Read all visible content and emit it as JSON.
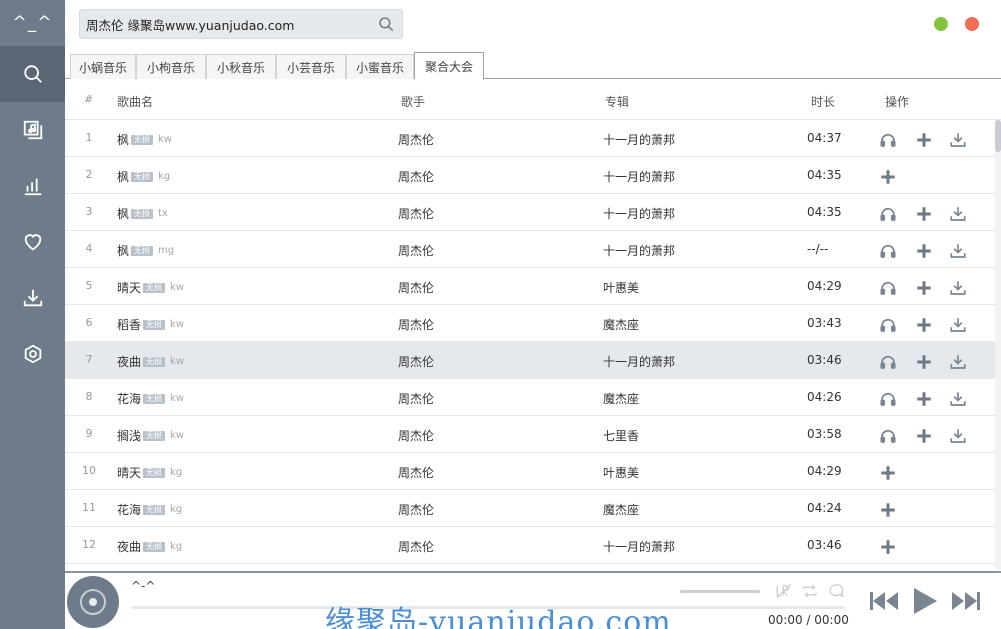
{
  "sidebar": {
    "logo": "^_^",
    "items": [
      {
        "icon": "search-icon"
      },
      {
        "icon": "music-folder-icon"
      },
      {
        "icon": "chart-icon"
      },
      {
        "icon": "heart-icon"
      },
      {
        "icon": "download-icon"
      },
      {
        "icon": "settings-icon"
      }
    ]
  },
  "search": {
    "value": "周杰伦 缘聚岛www.yuanjudao.com"
  },
  "tabs": [
    "小蜗音乐",
    "小枸音乐",
    "小秋音乐",
    "小芸音乐",
    "小蜜音乐",
    "聚合大会"
  ],
  "table": {
    "headers": {
      "index": "#",
      "name": "歌曲名",
      "singer": "歌手",
      "album": "专辑",
      "duration": "时长",
      "ops": "操作"
    },
    "rows": [
      {
        "i": "1",
        "name": "枫",
        "badge": "无损",
        "src": "kw",
        "singer": "周杰伦",
        "album": "十一月的萧邦",
        "dur": "04:37",
        "ops": [
          "h",
          "a",
          "d"
        ]
      },
      {
        "i": "2",
        "name": "枫",
        "badge": "无损",
        "src": "kg",
        "singer": "周杰伦",
        "album": "十一月的萧邦",
        "dur": "04:35",
        "ops": [
          "a"
        ]
      },
      {
        "i": "3",
        "name": "枫",
        "badge": "无损",
        "src": "tx",
        "singer": "周杰伦",
        "album": "十一月的萧邦",
        "dur": "04:35",
        "ops": [
          "h",
          "a",
          "d"
        ]
      },
      {
        "i": "4",
        "name": "枫",
        "badge": "无损",
        "src": "mg",
        "singer": "周杰伦",
        "album": "十一月的萧邦",
        "dur": "--/--",
        "ops": [
          "h",
          "a",
          "d"
        ]
      },
      {
        "i": "5",
        "name": "晴天",
        "badge": "无损",
        "src": "kw",
        "singer": "周杰伦",
        "album": "叶惠美",
        "dur": "04:29",
        "ops": [
          "h",
          "a",
          "d"
        ]
      },
      {
        "i": "6",
        "name": "稻香",
        "badge": "无损",
        "src": "kw",
        "singer": "周杰伦",
        "album": "魔杰座",
        "dur": "03:43",
        "ops": [
          "h",
          "a",
          "d"
        ]
      },
      {
        "i": "7",
        "name": "夜曲",
        "badge": "无损",
        "src": "kw",
        "singer": "周杰伦",
        "album": "十一月的萧邦",
        "dur": "03:46",
        "ops": [
          "h",
          "a",
          "d"
        ],
        "highlight": true
      },
      {
        "i": "8",
        "name": "花海",
        "badge": "无损",
        "src": "kw",
        "singer": "周杰伦",
        "album": "魔杰座",
        "dur": "04:26",
        "ops": [
          "h",
          "a",
          "d"
        ]
      },
      {
        "i": "9",
        "name": "搁浅",
        "badge": "无损",
        "src": "kw",
        "singer": "周杰伦",
        "album": "七里香",
        "dur": "03:58",
        "ops": [
          "h",
          "a",
          "d"
        ]
      },
      {
        "i": "10",
        "name": "晴天",
        "badge": "无损",
        "src": "kg",
        "singer": "周杰伦",
        "album": "叶惠美",
        "dur": "04:29",
        "ops": [
          "a"
        ]
      },
      {
        "i": "11",
        "name": "花海",
        "badge": "无损",
        "src": "kg",
        "singer": "周杰伦",
        "album": "魔杰座",
        "dur": "04:24",
        "ops": [
          "a"
        ]
      },
      {
        "i": "12",
        "name": "夜曲",
        "badge": "无损",
        "src": "kg",
        "singer": "周杰伦",
        "album": "十一月的萧邦",
        "dur": "03:46",
        "ops": [
          "a"
        ]
      }
    ]
  },
  "player": {
    "title": "^-^",
    "time": "00:00 / 00:00",
    "watermark": "缘聚岛-yuanjudao.com"
  },
  "colors": {
    "sidebar": "#6d7b8a",
    "sidebar_active": "#5a6674",
    "dot_green": "#86c440",
    "dot_red": "#f06e55",
    "row_highlight": "#e5e8ec",
    "watermark": "#4a8fd6"
  }
}
